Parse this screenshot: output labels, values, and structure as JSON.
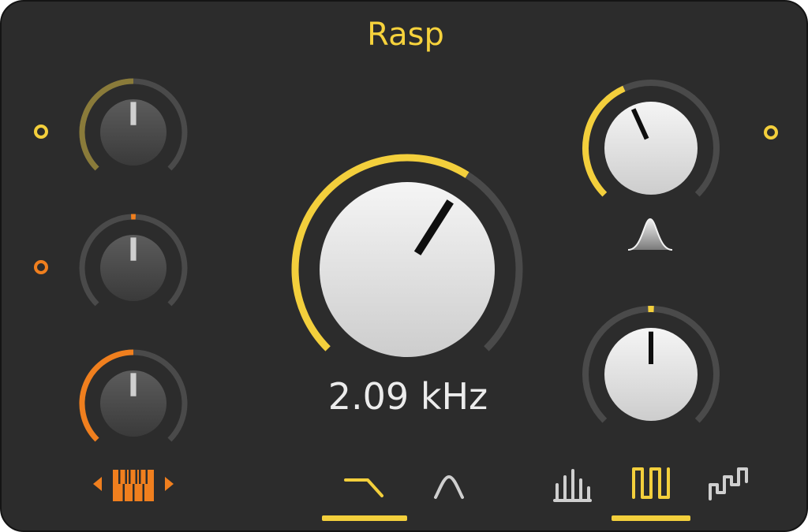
{
  "title": "Rasp",
  "readout": "2.09 kHz",
  "colors": {
    "panel": "#2c2c2c",
    "yellow": "#f3cf3c",
    "orange": "#f07f1e",
    "olive": "#8a7b3a",
    "track": "#4a4a4a"
  },
  "knobs": {
    "left_top": {
      "value": 0.5,
      "style": "dark",
      "accent": "olive",
      "modulation": "from-min"
    },
    "left_mid": {
      "value": 0.5,
      "style": "dark",
      "accent": "orange",
      "modulation": "marker"
    },
    "left_bottom": {
      "value": 0.5,
      "style": "dark",
      "accent": "orange",
      "modulation": "from-min"
    },
    "main_cutoff": {
      "value": 0.62,
      "style": "light",
      "accent": "yellow",
      "modulation": "from-min"
    },
    "right_top": {
      "value": 0.41,
      "style": "light",
      "accent": "yellow",
      "modulation": "from-min"
    },
    "right_bottom": {
      "value": 0.5,
      "style": "light",
      "accent": "yellow",
      "modulation": "marker"
    }
  },
  "ports": [
    {
      "name": "mod-port-top-left",
      "color": "yellow"
    },
    {
      "name": "mod-port-mid-left",
      "color": "orange"
    },
    {
      "name": "mod-port-right",
      "color": "yellow"
    }
  ],
  "icons": {
    "keytrack": "keytrack-icon",
    "resonance": "resonance-peak-icon",
    "lowpass": "lowpass-filter-icon",
    "bandpass": "bandpass-filter-icon",
    "comb": "comb-waveform-icon",
    "square": "square-waveform-icon",
    "stepped": "stepped-waveform-icon"
  },
  "selection": {
    "filter_type": "lowpass",
    "waveform": "square"
  }
}
